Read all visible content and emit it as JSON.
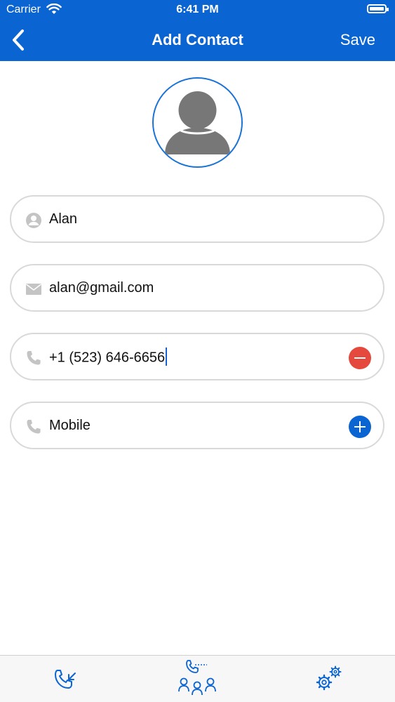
{
  "status_bar": {
    "carrier": "Carrier",
    "time": "6:41 PM"
  },
  "nav": {
    "title": "Add Contact",
    "save_label": "Save"
  },
  "fields": {
    "name": {
      "value": "Alan",
      "icon": "person-icon"
    },
    "email": {
      "value": "alan@gmail.com",
      "icon": "mail-icon"
    },
    "phone": {
      "value": "+1 (523) 646-6656",
      "icon": "phone-icon",
      "action": "remove"
    },
    "phone_type": {
      "value": "Mobile",
      "icon": "phone-icon",
      "action": "add"
    }
  },
  "tabs": [
    {
      "name": "calls",
      "icon": "phone-incoming-icon"
    },
    {
      "name": "contacts",
      "icon": "contacts-group-icon"
    },
    {
      "name": "settings",
      "icon": "gears-icon"
    }
  ],
  "colors": {
    "primary": "#0a64d2",
    "remove": "#e5493d",
    "border": "#d9d9d9",
    "icon_gray": "#c4c4c4"
  }
}
